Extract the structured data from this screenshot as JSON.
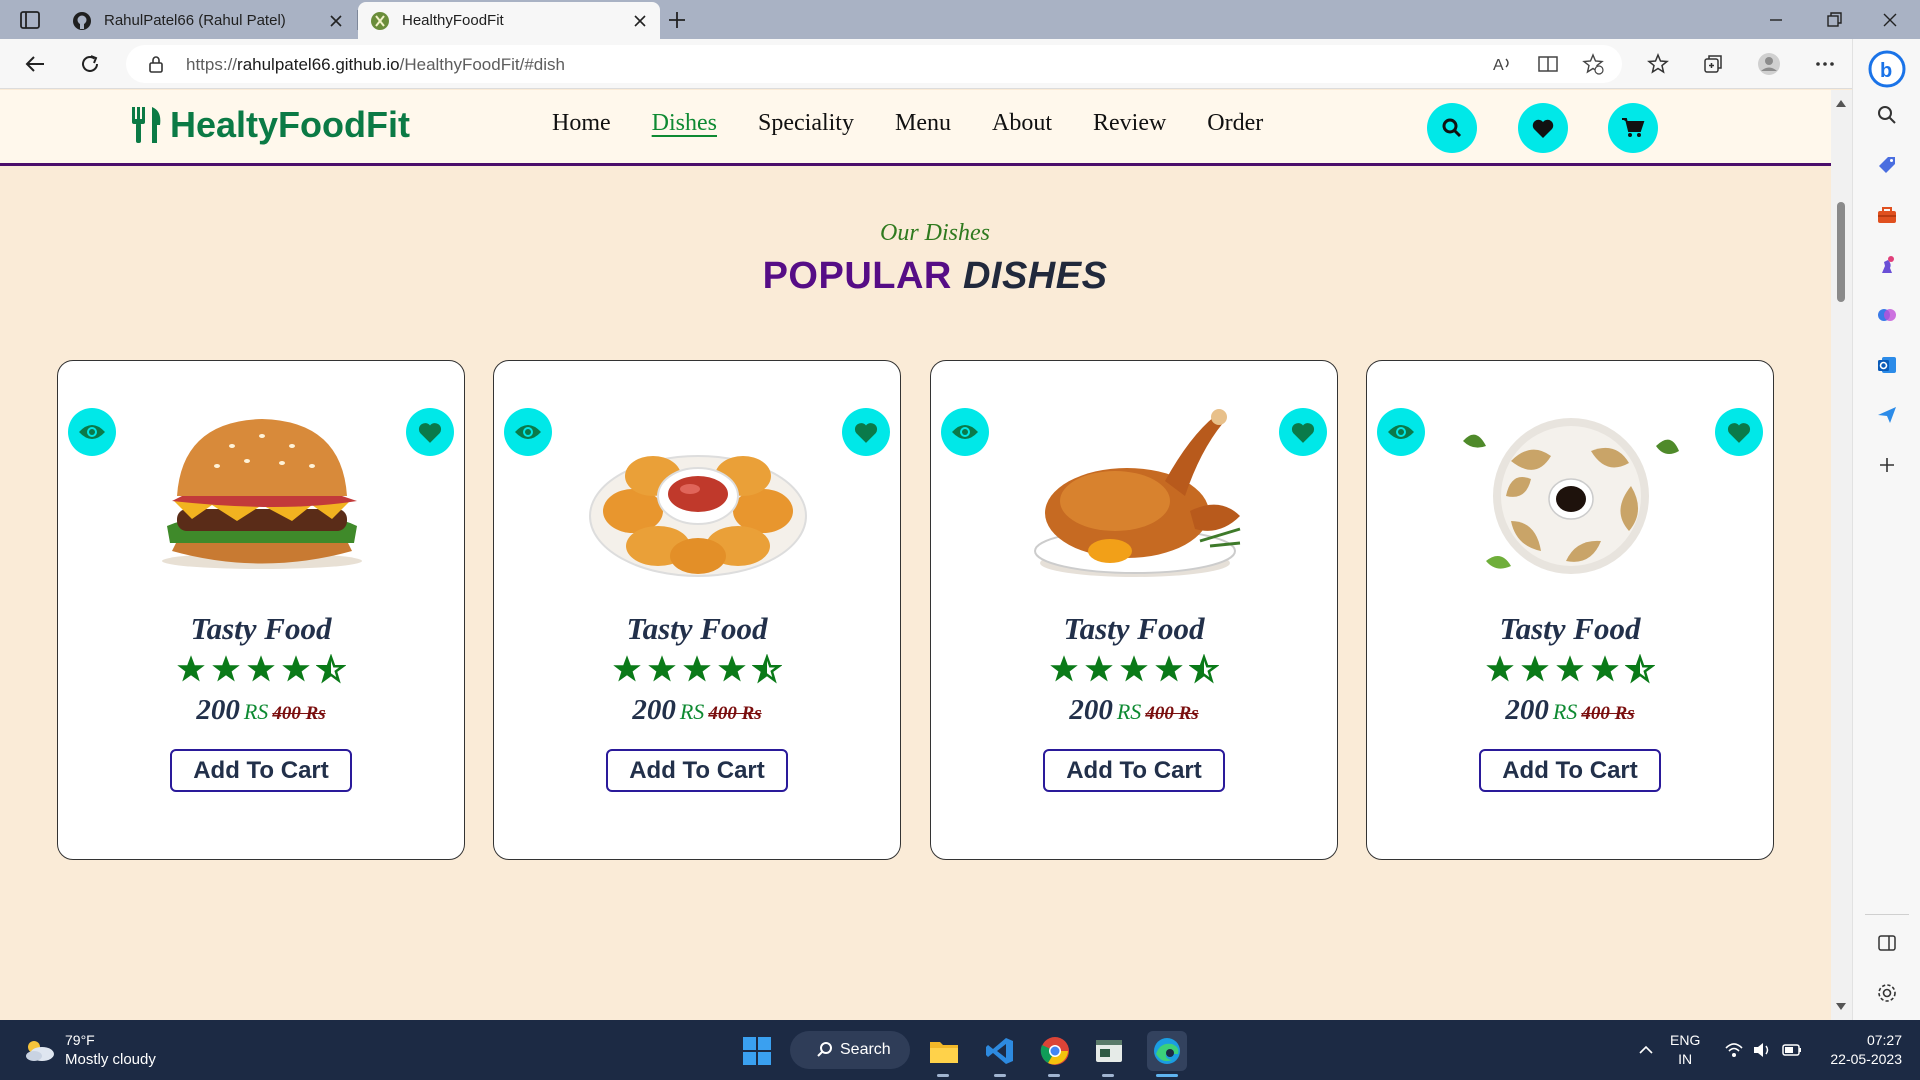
{
  "browser": {
    "tabs": [
      {
        "title": "RahulPatel66 (Rahul Patel)"
      },
      {
        "title": "HealthyFoodFit"
      }
    ],
    "url_prefix": "https://",
    "url_host": "rahulpatel66.github.io",
    "url_path": "/HealthyFoodFit/#dish"
  },
  "site": {
    "logo_text": "HealtyFoodFit",
    "nav": [
      "Home",
      "Dishes",
      "Speciality",
      "Menu",
      "About",
      "Review",
      "Order"
    ],
    "active_nav": "Dishes",
    "accent_color": "#00e8e8",
    "brand_color": "#0b7a45"
  },
  "section": {
    "subheading": "Our Dishes",
    "heading_main": "POPULAR",
    "heading_accent": "DISHES"
  },
  "dishes": [
    {
      "image": "burger",
      "name": "Tasty Food",
      "rating": 4.5,
      "price": "200",
      "currency": "RS",
      "old_price": "400 Rs",
      "button": "Add To Cart"
    },
    {
      "image": "nuggets",
      "name": "Tasty Food",
      "rating": 4.5,
      "price": "200",
      "currency": "RS",
      "old_price": "400 Rs",
      "button": "Add To Cart"
    },
    {
      "image": "roast-chicken",
      "name": "Tasty Food",
      "rating": 4.5,
      "price": "200",
      "currency": "RS",
      "old_price": "400 Rs",
      "button": "Add To Cart"
    },
    {
      "image": "dumplings",
      "name": "Tasty Food",
      "rating": 4.5,
      "price": "200",
      "currency": "RS",
      "old_price": "400 Rs",
      "button": "Add To Cart"
    }
  ],
  "taskbar": {
    "weather_temp": "79°F",
    "weather_desc": "Mostly cloudy",
    "search_label": "Search",
    "lang_top": "ENG",
    "lang_bottom": "IN",
    "time": "07:27",
    "date": "22-05-2023"
  }
}
